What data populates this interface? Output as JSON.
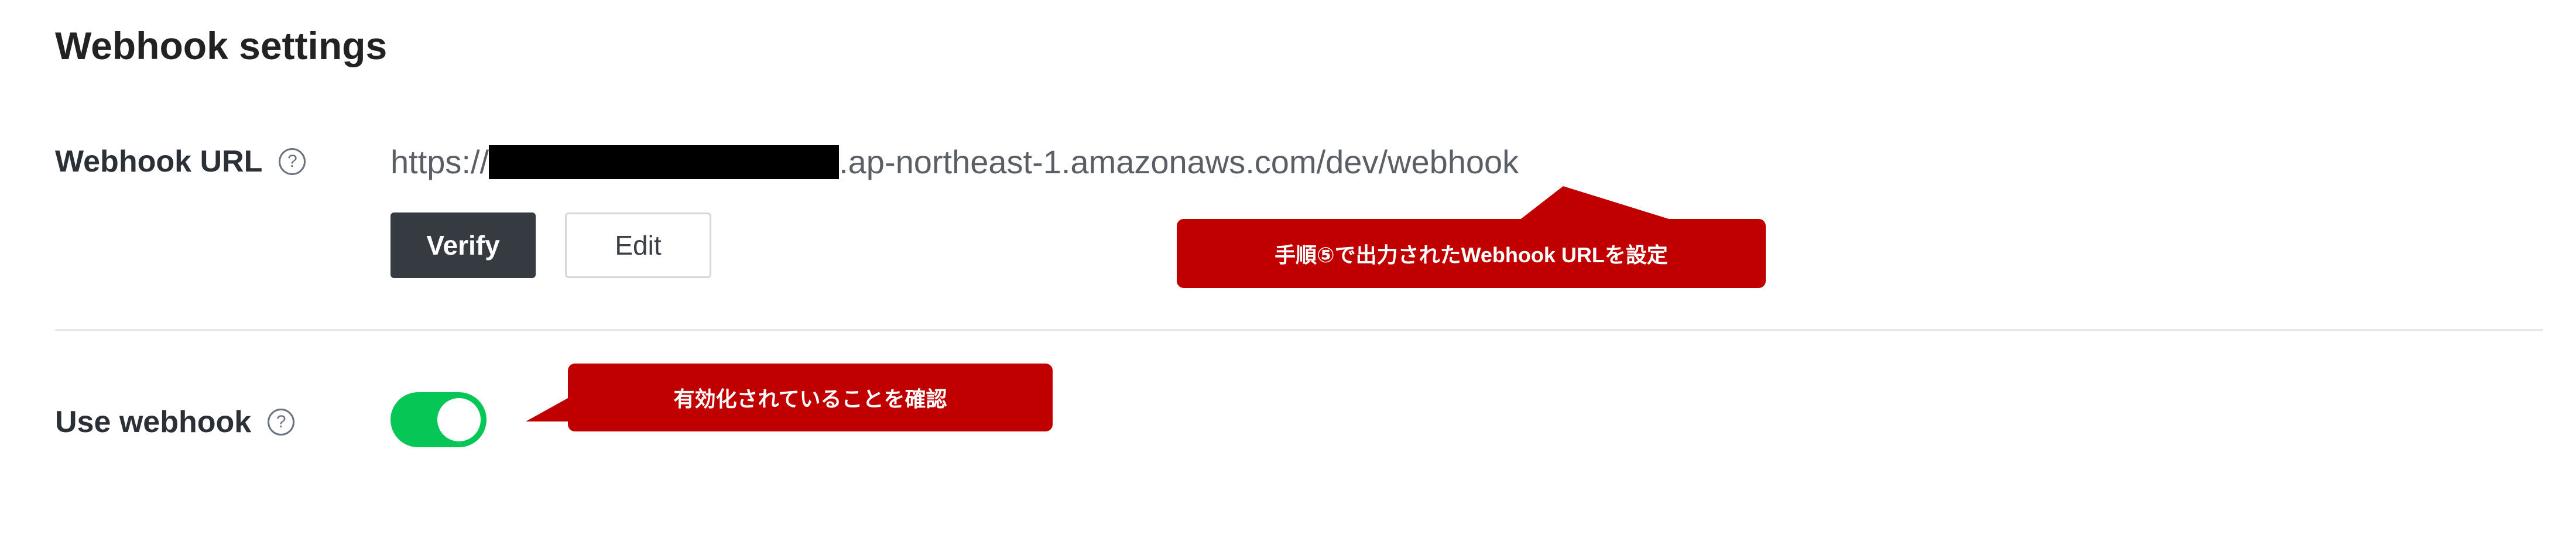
{
  "section": {
    "title": "Webhook settings"
  },
  "webhook_url": {
    "label": "Webhook URL",
    "help_glyph": "?",
    "url_prefix": "https://",
    "url_suffix": ".ap-northeast-1.amazonaws.com/dev/webhook",
    "redacted": true
  },
  "buttons": {
    "verify_label": "Verify",
    "edit_label": "Edit"
  },
  "use_webhook": {
    "label": "Use webhook",
    "help_glyph": "?",
    "enabled": true
  },
  "annotations": {
    "url_callout": "手順⑤で出力されたWebhook URLを設定",
    "toggle_callout": "有効化されていることを確認"
  },
  "colors": {
    "toggle_on": "#06c755",
    "verify_bg": "#363b42",
    "callout_red": "#c00000"
  }
}
